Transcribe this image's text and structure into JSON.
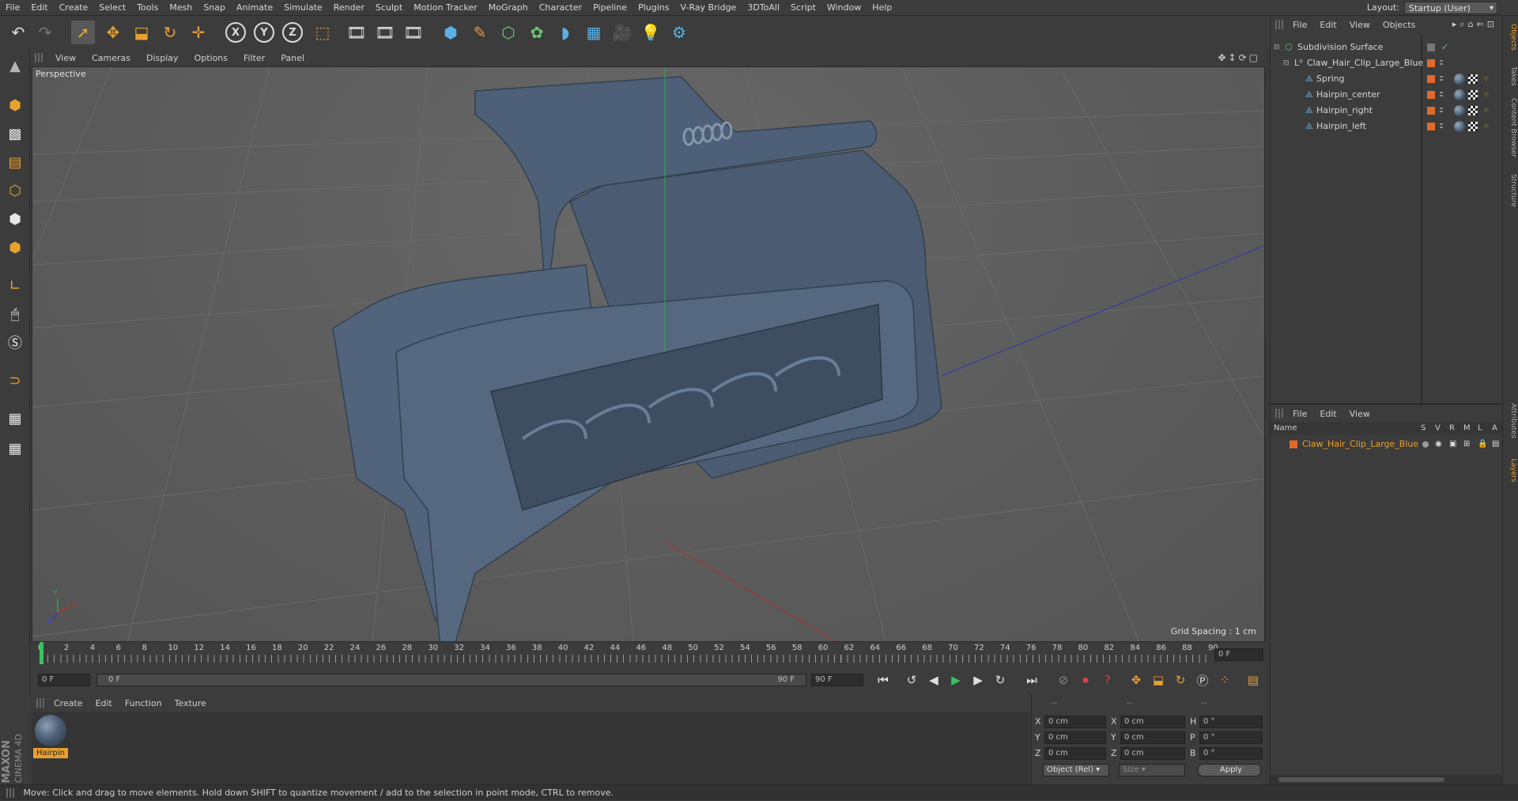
{
  "menubar": {
    "items": [
      "File",
      "Edit",
      "Create",
      "Select",
      "Tools",
      "Mesh",
      "Snap",
      "Animate",
      "Simulate",
      "Render",
      "Sculpt",
      "Motion Tracker",
      "MoGraph",
      "Character",
      "Pipeline",
      "Plugins",
      "V-Ray Bridge",
      "3DToAll",
      "Script",
      "Window",
      "Help"
    ],
    "layout_label": "Layout:",
    "layout_value": "Startup (User)"
  },
  "toolbar": {
    "icons": [
      "undo-icon",
      "redo-icon",
      "select-live-icon",
      "move-icon",
      "scale-icon",
      "rotate-icon",
      "add-object-icon",
      "x-axis-icon",
      "y-axis-icon",
      "z-axis-icon",
      "coordinate-system-icon",
      "render-view-icon",
      "render-picture-viewer-icon",
      "edit-render-settings-icon",
      "cube-icon",
      "pen-spline-icon",
      "subdivision-icon",
      "cloner-icon",
      "deformer-icon",
      "floor-scene-icon",
      "camera-icon",
      "light-icon",
      "python-icon"
    ],
    "x_label": "X",
    "y_label": "Y",
    "z_label": "Z"
  },
  "viewport": {
    "menu": [
      "View",
      "Cameras",
      "Display",
      "Options",
      "Filter",
      "Panel"
    ],
    "label": "Perspective",
    "grid_spacing": "Grid Spacing : 1 cm",
    "axis_y": "Y",
    "axis_x": "X",
    "axis_z": "Z"
  },
  "timeline": {
    "ticks": [
      "0",
      "2",
      "4",
      "6",
      "8",
      "10",
      "12",
      "14",
      "16",
      "18",
      "20",
      "22",
      "24",
      "26",
      "28",
      "30",
      "32",
      "34",
      "36",
      "38",
      "40",
      "42",
      "44",
      "46",
      "48",
      "50",
      "52",
      "54",
      "56",
      "58",
      "60",
      "62",
      "64",
      "66",
      "68",
      "70",
      "72",
      "74",
      "76",
      "78",
      "80",
      "82",
      "84",
      "86",
      "88",
      "90"
    ],
    "current_frame_right": "0 F",
    "start_field": "0 F",
    "range_start": "0 F",
    "range_end": "90 F",
    "end_field": "90 F"
  },
  "material_manager": {
    "menu": [
      "Create",
      "Edit",
      "Function",
      "Texture"
    ],
    "material_name": "Hairpin"
  },
  "coordinates": {
    "headers": [
      "--",
      "--",
      "--"
    ],
    "rows": [
      {
        "a": "X",
        "a_val": "0 cm",
        "b": "X",
        "b_val": "0 cm",
        "c": "H",
        "c_val": "0 °"
      },
      {
        "a": "Y",
        "a_val": "0 cm",
        "b": "Y",
        "b_val": "0 cm",
        "c": "P",
        "c_val": "0 °"
      },
      {
        "a": "Z",
        "a_val": "0 cm",
        "b": "Z",
        "b_val": "0 cm",
        "c": "B",
        "c_val": "0 °"
      }
    ],
    "mode": "Object (Rel)",
    "size": "Size",
    "apply": "Apply"
  },
  "object_manager": {
    "menu": [
      "File",
      "Edit",
      "View",
      "Objects"
    ],
    "objects": [
      {
        "name": "Subdivision Surface",
        "indent": 0
      },
      {
        "name": "Claw_Hair_Clip_Large_Blue",
        "indent": 1
      },
      {
        "name": "Spring",
        "indent": 2
      },
      {
        "name": "Hairpin_center",
        "indent": 2
      },
      {
        "name": "Hairpin_right",
        "indent": 2
      },
      {
        "name": "Hairpin_left",
        "indent": 2
      }
    ]
  },
  "layer_manager": {
    "menu": [
      "File",
      "Edit",
      "View"
    ],
    "columns": [
      "Name",
      "S",
      "V",
      "R",
      "M",
      "L",
      "A"
    ],
    "layers": [
      {
        "name": "Claw_Hair_Clip_Large_Blue"
      }
    ]
  },
  "side_tabs": [
    "Objects",
    "Takes",
    "Content Browser",
    "Structure",
    "Attributes",
    "Layers"
  ],
  "branding": {
    "line1": "MAXON",
    "line2": "CINEMA 4D"
  },
  "status": "Move: Click and drag to move elements. Hold down SHIFT to quantize movement / add to the selection in point mode, CTRL to remove.",
  "colors": {
    "accent_orange": "#e8a030",
    "layer_orange": "#e06a2c",
    "model_blue": "#4c5f77"
  }
}
